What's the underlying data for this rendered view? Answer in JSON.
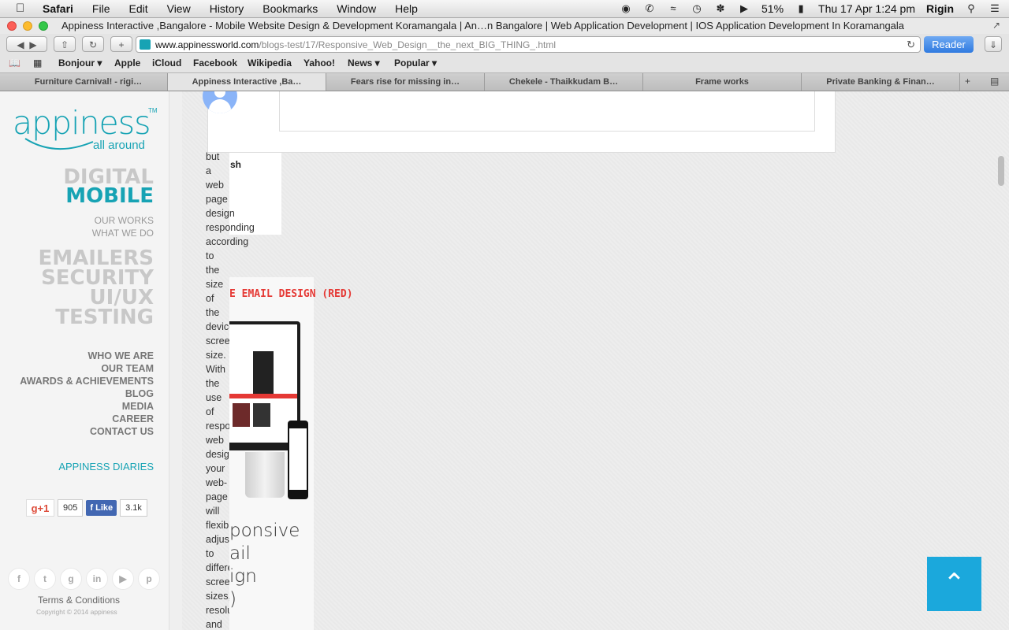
{
  "menubar": {
    "app": "Safari",
    "menus": [
      "File",
      "Edit",
      "View",
      "History",
      "Bookmarks",
      "Window",
      "Help"
    ],
    "battery": "51%",
    "datetime": "Thu 17 Apr  1:24 pm",
    "user": "Rigin"
  },
  "window": {
    "title": "Appiness Interactive ,Bangalore - Mobile Website Design & Development Koramangala | An…n Bangalore | Web Application Development | IOS Application Development In Koramangala"
  },
  "toolbar": {
    "url_host": "www.appinessworld.com",
    "url_path": "/blogs-test/17/Responsive_Web_Design__the_next_BIG_THING_.html",
    "reader_label": "Reader"
  },
  "bookmarks": [
    "Bonjour ▾",
    "Apple",
    "iCloud",
    "Facebook",
    "Wikipedia",
    "Yahoo!",
    "News ▾",
    "Popular ▾"
  ],
  "tabs": [
    {
      "label": "Furniture Carnival! - rigi…",
      "active": false
    },
    {
      "label": "Appiness Interactive ,Ba…",
      "active": true
    },
    {
      "label": "Fears rise for missing in…",
      "active": false
    },
    {
      "label": "Chekele - Thaikkudam B…",
      "active": false
    },
    {
      "label": "Frame works",
      "active": false
    },
    {
      "label": "Private Banking & Finan…",
      "active": false
    }
  ],
  "sidebar": {
    "logo_text": "appiness",
    "logo_tm": "TM",
    "logo_tagline": "all around",
    "digital": "DIGITAL",
    "mobile": "MOBILE",
    "our_works": "OUR WORKS",
    "what_we_do": "WHAT WE DO",
    "services": [
      "EMAILERS",
      "SECURITY",
      "UI/UX",
      "TESTING"
    ],
    "nav": [
      "WHO WE ARE",
      "OUR TEAM",
      "AWARDS & ACHIEVEMENTS",
      "BLOG",
      "MEDIA",
      "CAREER",
      "CONTACT US"
    ],
    "diaries": "APPINESS DIARIES",
    "gplus_label": "g+1",
    "gplus_count": "905",
    "fb_label": "Like",
    "fb_count": "3.1k",
    "terms": "Terms & Conditions",
    "copyright": "Copyright © 2014 appiness"
  },
  "content": {
    "author_name": "sh",
    "body_words": [
      "but",
      "a",
      "web",
      "page",
      "design",
      "responding",
      "according",
      "to",
      "the",
      "size",
      "of",
      "the",
      "device's",
      "screen",
      "size.",
      "With",
      "the",
      "use",
      "of",
      "responsive",
      "web",
      "design",
      "your",
      "web-",
      "page",
      "will",
      "flexibly",
      "adjust",
      "to",
      "different",
      "screen",
      "sizes,",
      "resolution",
      "and"
    ],
    "card_image_title": "E EMAIL DESIGN (RED)",
    "card_title_lines": [
      "ponsive",
      "ail",
      "ign",
      ")"
    ]
  }
}
